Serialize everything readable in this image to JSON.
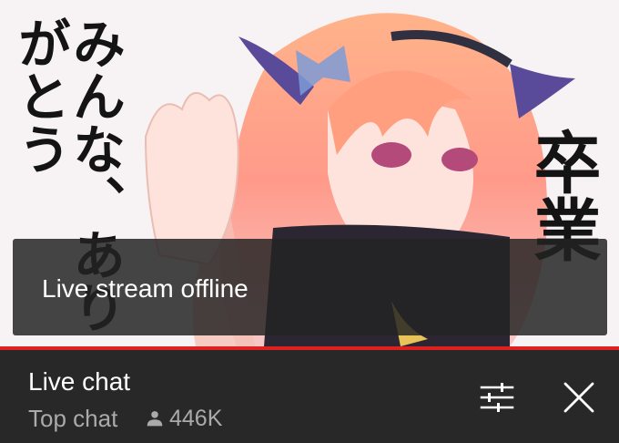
{
  "player": {
    "offline_message": "Live stream offline",
    "thumbnail_text_left": "みんな、ありがとう",
    "thumbnail_text_right": "卒業"
  },
  "chat": {
    "title": "Live chat",
    "filter_label": "Top chat",
    "viewer_count": "446K"
  },
  "icons": {
    "settings": "sliders-icon",
    "close": "close-icon",
    "viewers": "person-icon"
  },
  "colors": {
    "progress": "#e02020",
    "panel_bg": "#282828",
    "secondary_text": "#aaaaaa"
  }
}
